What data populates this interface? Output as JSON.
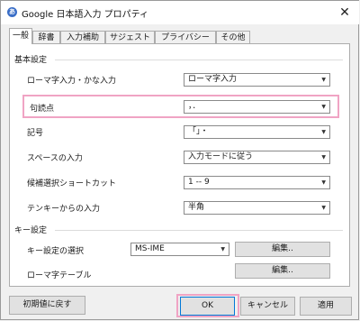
{
  "window": {
    "title": "Google 日本語入力 プロパティ",
    "icon": "app-icon"
  },
  "tabs": [
    {
      "label": "一般",
      "active": true
    },
    {
      "label": "辞書"
    },
    {
      "label": "入力補助"
    },
    {
      "label": "サジェスト"
    },
    {
      "label": "プライバシー"
    },
    {
      "label": "その他"
    }
  ],
  "basic": {
    "heading": "基本設定",
    "rows": [
      {
        "label": "ローマ字入力・かな入力",
        "value": "ローマ字入力"
      },
      {
        "label": "句読点",
        "value": "，．"
      },
      {
        "label": "記号",
        "value": "「」・"
      },
      {
        "label": "スペースの入力",
        "value": "入力モードに従う"
      },
      {
        "label": "候補選択ショートカット",
        "value": "1 -- 9"
      },
      {
        "label": "テンキーからの入力",
        "value": "半角"
      }
    ]
  },
  "keys": {
    "heading": "キー設定",
    "select_label": "キー設定の選択",
    "select_value": "MS-IME",
    "edit_label": "編集..",
    "romaji_label": "ローマ字テーブル",
    "romaji_edit_label": "編集.."
  },
  "footer": {
    "reset_label": "初期値に戻す",
    "ok_label": "OK",
    "cancel_label": "キャンセル",
    "apply_label": "適用"
  },
  "colors": {
    "highlight": "#f0a4c4",
    "accent": "#0078d7"
  }
}
